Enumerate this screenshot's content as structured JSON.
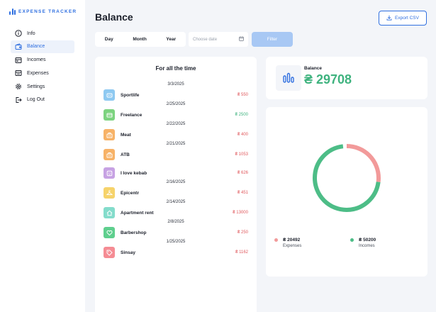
{
  "app": {
    "title": "EXPENSE TRACKER",
    "brand_color": "#2f6fe0"
  },
  "sidebar": {
    "items": [
      {
        "label": "Info",
        "icon": "info-icon",
        "active": false
      },
      {
        "label": "Balance",
        "icon": "wallet-icon",
        "active": true
      },
      {
        "label": "Incomes",
        "icon": "incomes-icon",
        "active": false
      },
      {
        "label": "Expenses",
        "icon": "expenses-icon",
        "active": false
      },
      {
        "label": "Settings",
        "icon": "gear-icon",
        "active": false
      },
      {
        "label": "Log Out",
        "icon": "logout-icon",
        "active": false
      }
    ]
  },
  "header": {
    "title": "Balance",
    "export_label": "Export CSV"
  },
  "filters": {
    "periods": [
      "Day",
      "Month",
      "Year"
    ],
    "date_placeholder": "Choose date",
    "filter_label": "Filter"
  },
  "transactions": {
    "title": "For all the time",
    "groups": [
      {
        "date": "3/3/2025",
        "items": [
          {
            "name": "Sportlife",
            "amount": "₴ 550",
            "type": "expense",
            "icon": "dumbbell-icon",
            "color": "#8ec9f1"
          }
        ]
      },
      {
        "date": "2/25/2025",
        "items": [
          {
            "name": "Freelance",
            "amount": "₴ 2500",
            "type": "income",
            "icon": "laptop-icon",
            "color": "#7cd37f"
          }
        ]
      },
      {
        "date": "2/22/2025",
        "items": [
          {
            "name": "Meat",
            "amount": "₴ 400",
            "type": "expense",
            "icon": "basket-icon",
            "color": "#f7b267"
          }
        ]
      },
      {
        "date": "2/21/2025",
        "items": [
          {
            "name": "ATB",
            "amount": "₴ 1053",
            "type": "expense",
            "icon": "basket-icon",
            "color": "#f7b267"
          },
          {
            "name": "I love kebab",
            "amount": "₴ 626",
            "type": "expense",
            "icon": "food-icon",
            "color": "#c7a2e3"
          }
        ]
      },
      {
        "date": "2/16/2025",
        "items": [
          {
            "name": "Epicentr",
            "amount": "₴ 451",
            "type": "expense",
            "icon": "hanger-icon",
            "color": "#f6d36b"
          }
        ]
      },
      {
        "date": "2/14/2025",
        "items": [
          {
            "name": "Apartment rent",
            "amount": "₴ 13000",
            "type": "expense",
            "icon": "home-icon",
            "color": "#84dccb"
          }
        ]
      },
      {
        "date": "2/8/2025",
        "items": [
          {
            "name": "Barbershop",
            "amount": "₴ 250",
            "type": "expense",
            "icon": "heart-icon",
            "color": "#5fcf8e"
          }
        ]
      },
      {
        "date": "1/25/2025",
        "items": [
          {
            "name": "Sinsay",
            "amount": "₴ 1162",
            "type": "expense",
            "icon": "tag-icon",
            "color": "#f58c94"
          }
        ]
      }
    ]
  },
  "balance": {
    "label": "Balance",
    "value": "₴ 29708",
    "color": "#3fb37f"
  },
  "summary": {
    "expenses": {
      "value": "₴ 20492",
      "label": "Expenses",
      "color": "#f29a9a"
    },
    "incomes": {
      "value": "₴ 50200",
      "label": "Incomes",
      "color": "#4dbd87"
    }
  },
  "colors": {
    "expense": "#e0595d",
    "income": "#3fb37f"
  },
  "chart_data": {
    "type": "pie",
    "categories": [
      "Expenses",
      "Incomes"
    ],
    "values": [
      20492,
      50200
    ],
    "colors": [
      "#f29a9a",
      "#4dbd87"
    ]
  }
}
